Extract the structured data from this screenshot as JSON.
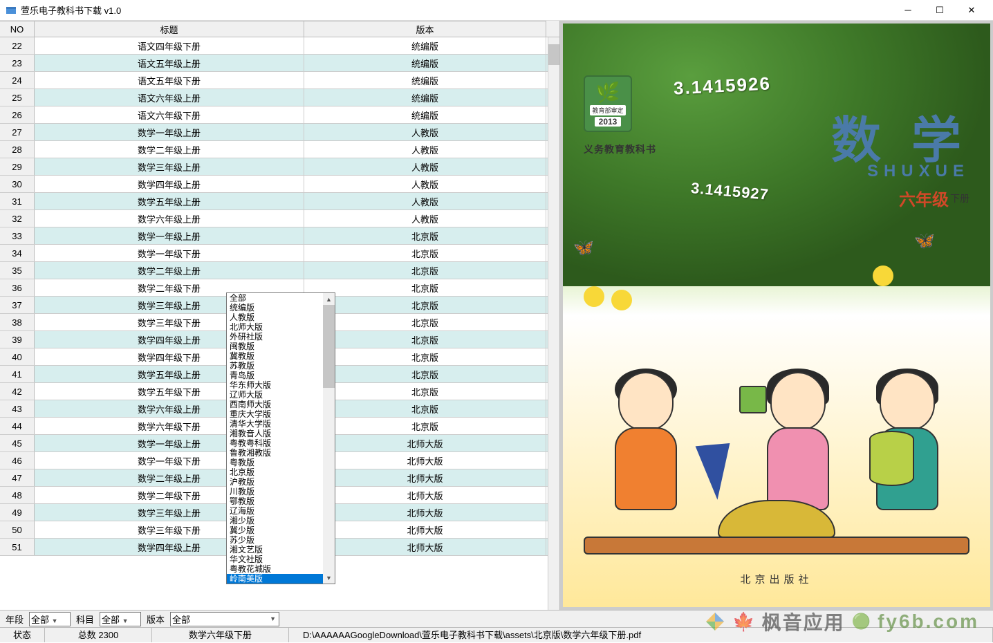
{
  "window": {
    "title": "萱乐电子教科书下载 v1.0"
  },
  "columns": {
    "no": "NO",
    "title": "标题",
    "version": "版本"
  },
  "rows": [
    {
      "no": "22",
      "title": "语文四年级下册",
      "ver": "统编版"
    },
    {
      "no": "23",
      "title": "语文五年级上册",
      "ver": "统编版"
    },
    {
      "no": "24",
      "title": "语文五年级下册",
      "ver": "统编版"
    },
    {
      "no": "25",
      "title": "语文六年级上册",
      "ver": "统编版"
    },
    {
      "no": "26",
      "title": "语文六年级下册",
      "ver": "统编版"
    },
    {
      "no": "27",
      "title": "数学一年级上册",
      "ver": "人教版"
    },
    {
      "no": "28",
      "title": "数学二年级上册",
      "ver": "人教版"
    },
    {
      "no": "29",
      "title": "数学三年级上册",
      "ver": "人教版"
    },
    {
      "no": "30",
      "title": "数学四年级上册",
      "ver": "人教版"
    },
    {
      "no": "31",
      "title": "数学五年级上册",
      "ver": "人教版"
    },
    {
      "no": "32",
      "title": "数学六年级上册",
      "ver": "人教版"
    },
    {
      "no": "33",
      "title": "数学一年级上册",
      "ver": "北京版"
    },
    {
      "no": "34",
      "title": "数学一年级下册",
      "ver": "北京版"
    },
    {
      "no": "35",
      "title": "数学二年级上册",
      "ver": "北京版"
    },
    {
      "no": "36",
      "title": "数学二年级下册",
      "ver": "北京版"
    },
    {
      "no": "37",
      "title": "数学三年级上册",
      "ver": "北京版"
    },
    {
      "no": "38",
      "title": "数学三年级下册",
      "ver": "北京版"
    },
    {
      "no": "39",
      "title": "数学四年级上册",
      "ver": "北京版"
    },
    {
      "no": "40",
      "title": "数学四年级下册",
      "ver": "北京版"
    },
    {
      "no": "41",
      "title": "数学五年级上册",
      "ver": "北京版"
    },
    {
      "no": "42",
      "title": "数学五年级下册",
      "ver": "北京版"
    },
    {
      "no": "43",
      "title": "数学六年级上册",
      "ver": "北京版"
    },
    {
      "no": "44",
      "title": "数学六年级下册",
      "ver": "北京版"
    },
    {
      "no": "45",
      "title": "数学一年级上册",
      "ver": "北师大版"
    },
    {
      "no": "46",
      "title": "数学一年级下册",
      "ver": "北师大版"
    },
    {
      "no": "47",
      "title": "数学二年级上册",
      "ver": "北师大版"
    },
    {
      "no": "48",
      "title": "数学二年级下册",
      "ver": "北师大版"
    },
    {
      "no": "49",
      "title": "数学三年级上册",
      "ver": "北师大版"
    },
    {
      "no": "50",
      "title": "数学三年级下册",
      "ver": "北师大版"
    },
    {
      "no": "51",
      "title": "数学四年级上册",
      "ver": "北师大版"
    }
  ],
  "dropdown": {
    "options": [
      "全部",
      "统编版",
      "人教版",
      "北师大版",
      "外研社版",
      "闽教版",
      "冀教版",
      "苏教版",
      "青岛版",
      "华东师大版",
      "辽师大版",
      "西南师大版",
      "重庆大学版",
      "清华大学版",
      "湘教音人版",
      "粤教粤科版",
      "鲁教湘教版",
      "粤教版",
      "北京版",
      "沪教版",
      "川教版",
      "鄂教版",
      "辽海版",
      "湘少版",
      "冀少版",
      "苏少版",
      "湘文艺版",
      "华文社版",
      "粤教花城版",
      "岭南美版"
    ],
    "selected": "岭南美版"
  },
  "filter": {
    "grade_label": "年段",
    "grade_value": "全部",
    "subject_label": "科目",
    "subject_value": "全部",
    "version_label": "版本",
    "version_value": "全部"
  },
  "status": {
    "state_label": "状态",
    "total": "总数 2300",
    "current": "数学六年级下册",
    "path": "D:\\AAAAAAGoogleDownload\\萱乐电子教科书下载\\assets\\北京版\\数学六年级下册.pdf"
  },
  "cover": {
    "badge_text": "教育部审定",
    "badge_year": "2013",
    "edu_text": "义务教育教科书",
    "subject": "数 学",
    "pinyin": "SHUXUE",
    "grade": "六年级",
    "volume": "下册",
    "pi1": "3.1415926",
    "pi2": "3.1415927",
    "publisher": "北京出版社"
  },
  "watermark": {
    "text1": "枫音应用",
    "text2": "fy6b.com"
  }
}
